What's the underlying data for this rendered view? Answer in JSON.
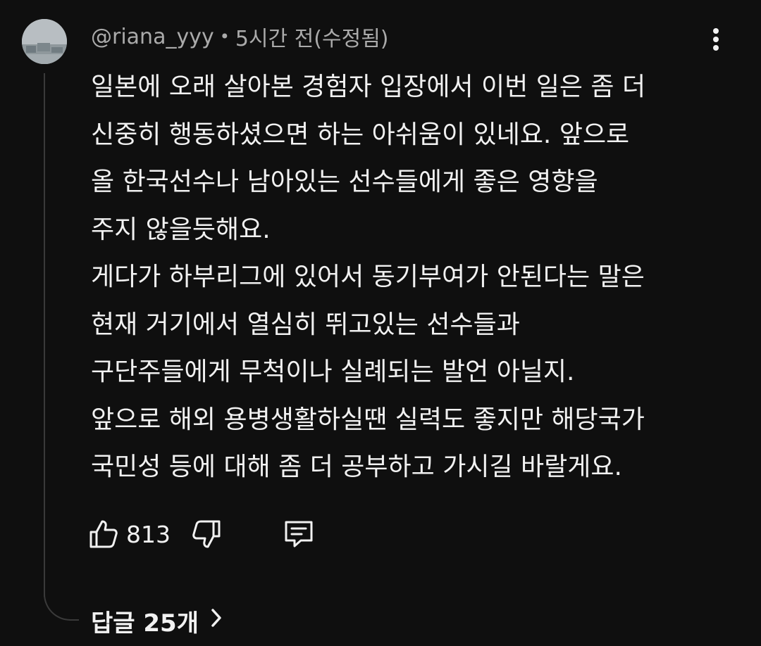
{
  "comment": {
    "author": "@riana_yyy",
    "separator": "•",
    "time": "5시간 전(수정됨)",
    "lines": [
      "일본에 오래 살아본 경험자 입장에서 이번 일은 좀 더",
      "신중히 행동하셨으면 하는 아쉬움이 있네요. 앞으로",
      "올 한국선수나 남아있는 선수들에게 좋은 영향을",
      "주지 않을듯해요.",
      "게다가 하부리그에 있어서 동기부여가 안된다는 말은",
      "현재 거기에서 열심히 뛰고있는 선수들과",
      "구단주들에게 무척이나 실례되는 발언 아닐지.",
      "앞으로 해외 용병생활하실땐 실력도 좋지만 해당국가",
      "국민성 등에 대해 좀 더 공부하고 가시길 바랄게요."
    ],
    "like_count": "813",
    "replies_label": "답글 25개"
  },
  "icons": {
    "menu": "more-vert-icon",
    "like": "thumb-up-icon",
    "dislike": "thumb-down-icon",
    "reply": "comment-icon",
    "chevron": "chevron-right-icon"
  },
  "colors": {
    "background": "#0f0f0f",
    "text_primary": "#f1f1f1",
    "text_secondary": "#aaaaaa",
    "thread_line": "#3a3a3a"
  }
}
